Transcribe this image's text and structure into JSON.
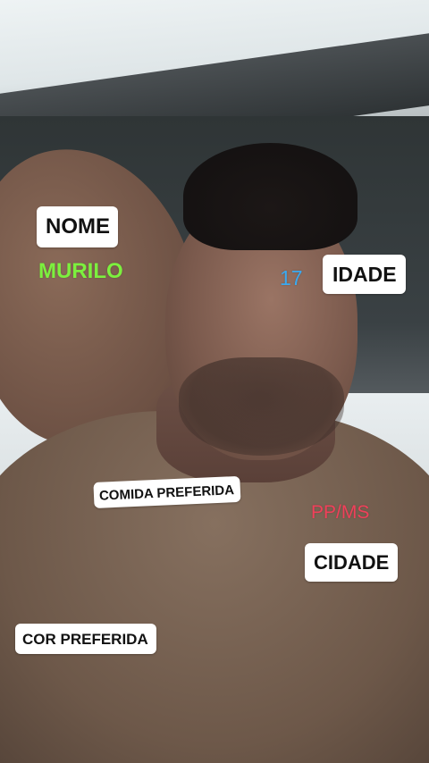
{
  "labels": {
    "nome": "NOME",
    "idade": "IDADE",
    "comida": "COMIDA PREFERIDA",
    "cidade": "CIDADE",
    "cor": "COR PREFERIDA"
  },
  "values": {
    "nome": "MURILO",
    "idade": "17",
    "cidade": "PP/MS"
  },
  "colors": {
    "nome_value": "#7cf03e",
    "idade_value": "#3aa9f0",
    "cidade_value": "#f0405a",
    "label_background": "#ffffff",
    "label_text": "#111111"
  }
}
